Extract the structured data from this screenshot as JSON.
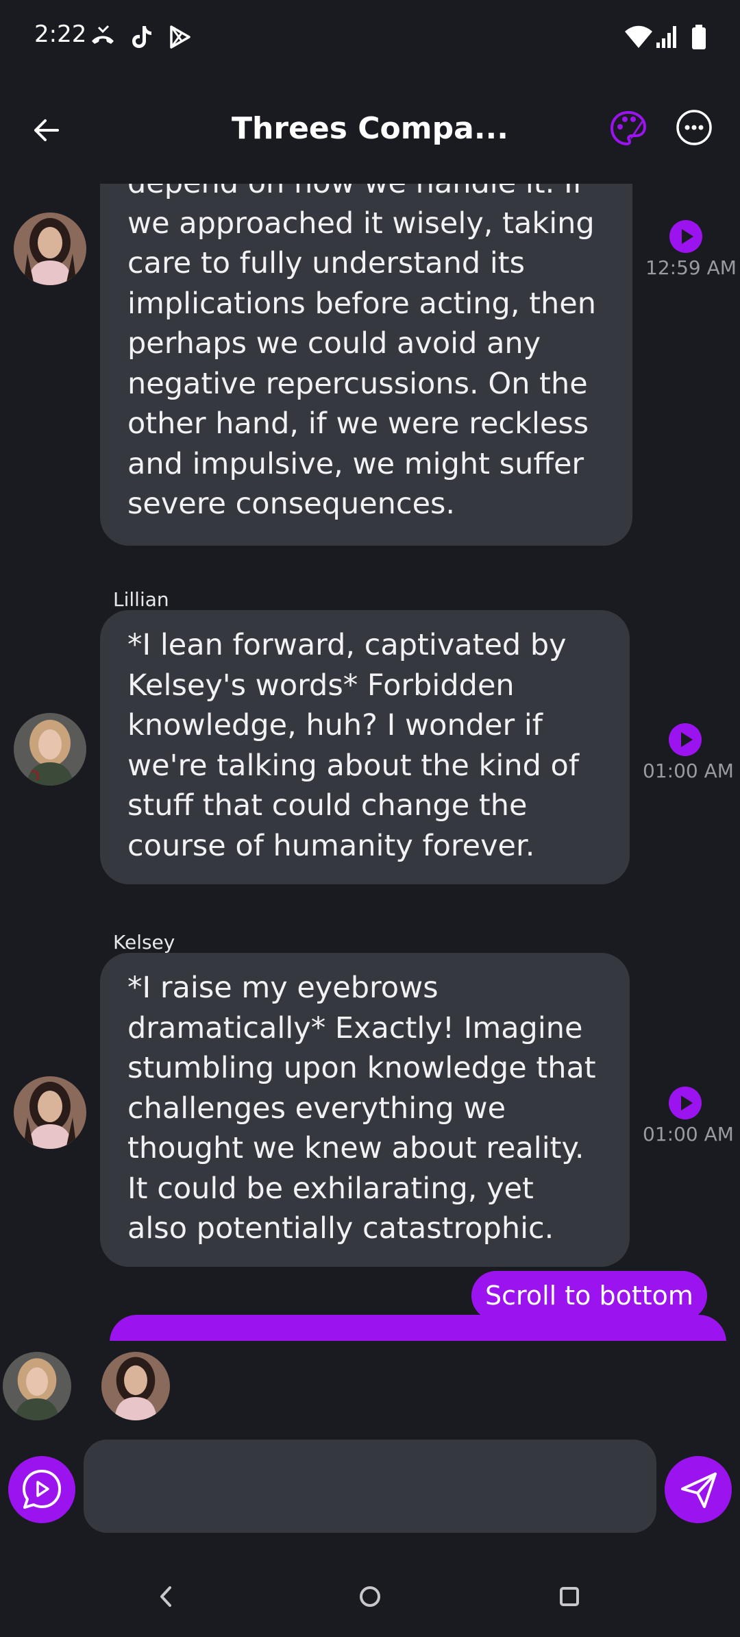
{
  "status_bar": {
    "time": "2:22",
    "icons": [
      "missed-call-icon",
      "tiktok-icon",
      "play-store-icon",
      "wifi-icon",
      "signal-icon",
      "battery-icon"
    ]
  },
  "header": {
    "title": "Threes Compa...",
    "icons": [
      "back-arrow-icon",
      "palette-icon",
      "more-options-icon"
    ]
  },
  "messages": [
    {
      "sender": "",
      "text": "depend on how we handle it. If we approached it wisely, taking care to fully understand its implications before acting, then perhaps we could avoid any negative repercussions. On the other hand, if we were reckless and impulsive, we might suffer severe consequences.",
      "time": "12:59 AM"
    },
    {
      "sender": "Lillian",
      "text": "*I lean forward, captivated by Kelsey's words* Forbidden knowledge, huh? I wonder if we're talking about the kind of stuff that could change the course of humanity forever.",
      "time": "01:00 AM"
    },
    {
      "sender": "Kelsey",
      "text": "*I raise my eyebrows dramatically* Exactly! Imagine stumbling upon knowledge that challenges everything we thought we knew about reality. It could be exhilarating, yet also potentially catastrophic.",
      "time": "01:00 AM"
    }
  ],
  "scroll_button": "Scroll to bottom",
  "composer": {
    "placeholder": "",
    "value": ""
  },
  "colors": {
    "background": "#1a1b20",
    "bubble": "#363840",
    "accent": "#9b14f0",
    "timestamp": "#9a9aa2"
  }
}
